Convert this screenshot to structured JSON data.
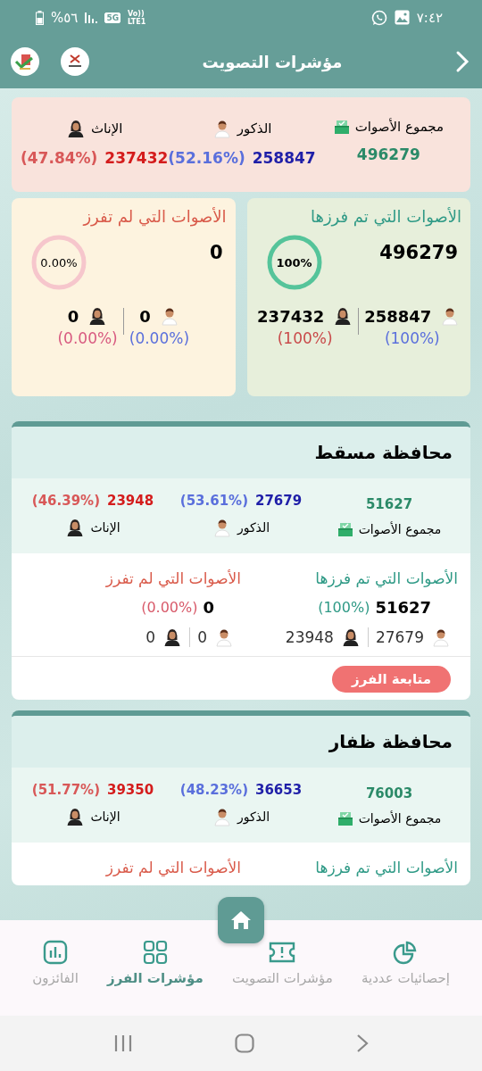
{
  "status_bar": {
    "time": "٧:٤٢",
    "battery": "%٥٦",
    "network": "5G",
    "volte": "Vo))",
    "lte": "LTE1"
  },
  "app_bar": {
    "title": "مؤشرات التصويت"
  },
  "summary": {
    "total": {
      "label": "مجموع الأصوات",
      "value": "496279"
    },
    "male": {
      "label": "الذكور",
      "value": "258847",
      "percent": "(52.16%)"
    },
    "female": {
      "label": "الإناث",
      "value": "237432",
      "percent": "(47.84%)"
    }
  },
  "sorting": [
    {
      "kind": "counted",
      "title": "الأصوات التي تم فرزها",
      "total": "496279",
      "ring": {
        "label": "100%"
      },
      "male": {
        "value": "258847",
        "percent": "(100%)"
      },
      "female": {
        "value": "237432",
        "percent": "(100%)"
      }
    },
    {
      "kind": "uncounted",
      "title": "الأصوات التي لم تفرز",
      "total": "0",
      "ring": {
        "label": "0.00%"
      },
      "male": {
        "value": "0",
        "percent": "(0.00%)"
      },
      "female": {
        "value": "0",
        "percent": "(0.00%)"
      }
    }
  ],
  "governorates": [
    {
      "name": "محافظة مسقط",
      "total": {
        "label": "مجموع الأصوات",
        "value": "51627"
      },
      "male": {
        "label": "الذكور",
        "value": "27679",
        "percent": "(53.61%)"
      },
      "female": {
        "label": "الإناث",
        "value": "23948",
        "percent": "(46.39%)"
      },
      "counted": {
        "title": "الأصوات التي تم فرزها",
        "total": "51627",
        "percent": "(100%)",
        "male": "27679",
        "female": "23948"
      },
      "uncounted": {
        "title": "الأصوات التي لم تفرز",
        "total": "0",
        "percent": "(0.00%)",
        "male": "0",
        "female": "0"
      },
      "button": "متابعة الفرز"
    },
    {
      "name": "محافظة ظفار",
      "total": {
        "label": "مجموع الأصوات",
        "value": "76003"
      },
      "male": {
        "label": "الذكور",
        "value": "36653",
        "percent": "(48.23%)"
      },
      "female": {
        "label": "الإناث",
        "value": "39350",
        "percent": "(51.77%)"
      },
      "counted": {
        "title": "الأصوات التي تم فرزها"
      },
      "uncounted": {
        "title": "الأصوات التي لم تفرز"
      }
    }
  ],
  "bottom_nav": {
    "items": [
      {
        "kind": "pie",
        "label": "إحصائيات عددية",
        "selected": false
      },
      {
        "kind": "ticket",
        "label": "مؤشرات التصويت",
        "selected": false
      },
      {
        "kind": "grid",
        "label": "مؤشرات الفرز",
        "selected": true
      },
      {
        "kind": "bars",
        "label": "الفائزون",
        "selected": false
      }
    ]
  }
}
